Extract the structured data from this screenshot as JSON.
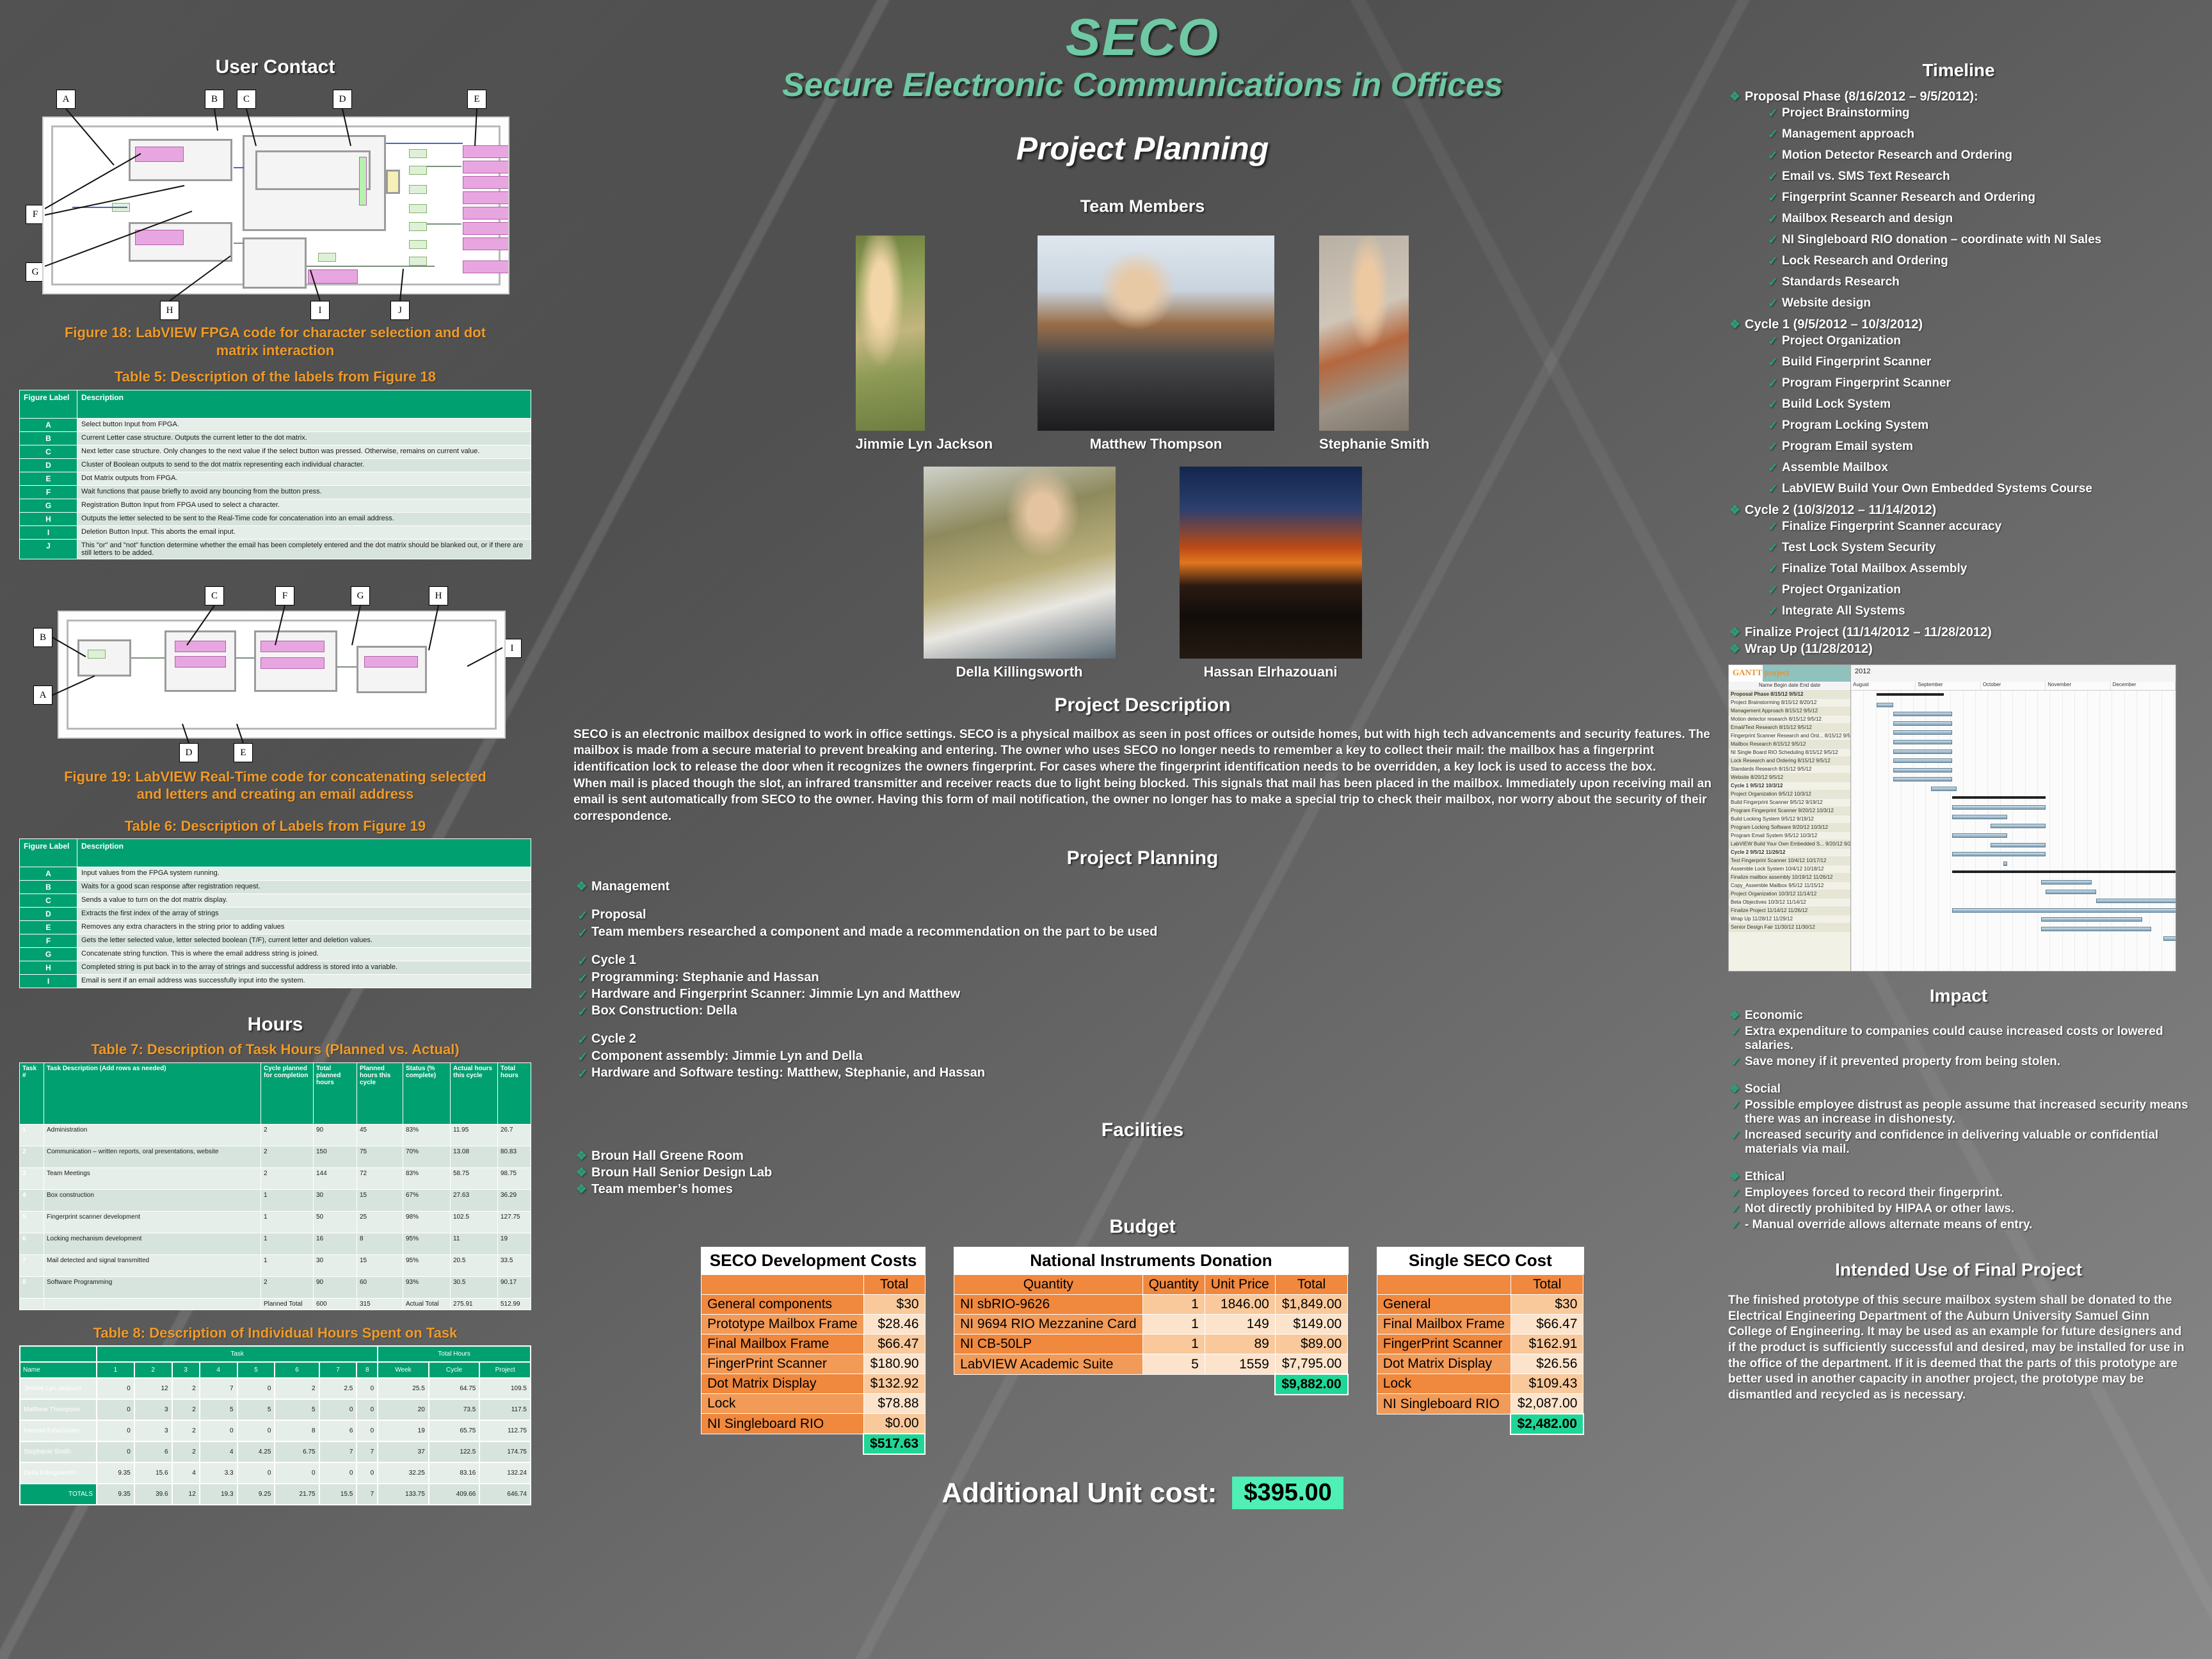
{
  "header": {
    "title": "SECO",
    "subtitle": "Secure Electronic Communications in Offices",
    "phase": "Project Planning",
    "team_members_label": "Team Members"
  },
  "colors": {
    "accent_green": "#2f9e75",
    "table_header_green": "#00a070",
    "budget_orange": "#f0883e",
    "total_green": "#1fd696",
    "caption_orange": "#ef9a28",
    "background": "#4a4a4a"
  },
  "left_column": {
    "figure18_title": "User Contact",
    "figure18_labels": [
      "A",
      "B",
      "C",
      "D",
      "E",
      "F",
      "G",
      "H",
      "I",
      "J"
    ],
    "figure18_caption": "Figure 18: LabVIEW FPGA code for character selection and dot matrix interaction",
    "table5_title": "Table 5: Description of the labels from Figure 18",
    "table5_headers": [
      "Figure Label",
      "Description"
    ],
    "table5_rows": [
      [
        "A",
        "Select button Input from FPGA."
      ],
      [
        "B",
        "Current Letter case structure. Outputs the current letter to the dot matrix."
      ],
      [
        "C",
        "Next letter case structure. Only changes to the next value if the select button was pressed. Otherwise, remains on current value."
      ],
      [
        "D",
        "Cluster of Boolean outputs to send to the dot matrix representing each individual character."
      ],
      [
        "E",
        "Dot Matrix outputs from FPGA."
      ],
      [
        "F",
        "Wait functions that pause briefly to avoid any bouncing from the button press."
      ],
      [
        "G",
        "Registration Button Input from FPGA used to select a character."
      ],
      [
        "H",
        "Outputs the letter selected to be sent to the Real-Time code for concatenation into an email address."
      ],
      [
        "I",
        "Deletion Button Input. This aborts the email input."
      ],
      [
        "J",
        "This \"or\" and \"not\" function determine whether the email has been completely entered and the dot matrix should be blanked out, or if there are still letters to be added."
      ]
    ],
    "figure19_labels": [
      "A",
      "B",
      "C",
      "D",
      "E",
      "F",
      "G",
      "H",
      "I"
    ],
    "figure19_caption": "Figure 19: LabVIEW Real-Time code for concatenating selected and letters and creating an email address",
    "table6_title": "Table 6: Description of Labels from Figure 19",
    "table6_headers": [
      "Figure Label",
      "Description"
    ],
    "table6_rows": [
      [
        "A",
        "Input values from the FPGA system running."
      ],
      [
        "B",
        "Waits for a good scan response after registration request."
      ],
      [
        "C",
        "Sends a value to turn on the dot matrix display."
      ],
      [
        "D",
        "Extracts the first index of the array of strings"
      ],
      [
        "E",
        "Removes any extra characters in the string prior to adding values"
      ],
      [
        "F",
        "Gets the letter selected value, letter selected boolean (T/F), current letter and deletion values."
      ],
      [
        "G",
        "Concatenate string function. This is where the email address string is joined."
      ],
      [
        "H",
        "Completed string is put back in to the array of strings and successful address is stored into a variable."
      ],
      [
        "I",
        "Email is sent if an email address was successfully input into the system."
      ]
    ],
    "hours_title": "Hours",
    "table7_title": "Table 7: Description of Task Hours (Planned vs. Actual)",
    "table7_headers": [
      "Task #",
      "Task Description (Add rows as needed)",
      "Cycle planned for completion",
      "Total planned hours",
      "Planned hours this cycle",
      "Status (% complete)",
      "Actual hours this cycle",
      "Total hours"
    ],
    "table7_rows": [
      [
        "1",
        "Administration",
        "2",
        "90",
        "45",
        "83%",
        "11.95",
        "26.7"
      ],
      [
        "2",
        "Communication – written reports, oral presentations, website",
        "2",
        "150",
        "75",
        "70%",
        "13.08",
        "80.83"
      ],
      [
        "3",
        "Team Meetings",
        "2",
        "144",
        "72",
        "83%",
        "58.75",
        "98.75"
      ],
      [
        "4",
        "Box construction",
        "1",
        "30",
        "15",
        "67%",
        "27.63",
        "36.29"
      ],
      [
        "5",
        "Fingerprint scanner development",
        "1",
        "50",
        "25",
        "98%",
        "102.5",
        "127.75"
      ],
      [
        "6",
        "Locking mechanism development",
        "1",
        "16",
        "8",
        "95%",
        "11",
        "19"
      ],
      [
        "7",
        "Mail detected and signal transmitted",
        "1",
        "30",
        "15",
        "95%",
        "20.5",
        "33.5"
      ],
      [
        "8",
        "Software Programming",
        "2",
        "90",
        "60",
        "93%",
        "30.5",
        "90.17"
      ]
    ],
    "table7_total_row": [
      "",
      "",
      "Planned Total",
      "600",
      "315",
      "Actual Total",
      "275.91",
      "512.99"
    ],
    "table8_title": "Table 8: Description of Individual Hours Spent on Task",
    "table8_group_headers": [
      "",
      "Task",
      "Total Hours"
    ],
    "table8_headers": [
      "Name",
      "1",
      "2",
      "3",
      "4",
      "5",
      "6",
      "7",
      "8",
      "Week",
      "Cycle",
      "Project"
    ],
    "table8_rows": [
      [
        "Jimmie Lyn Jackson",
        "0",
        "12",
        "2",
        "7",
        "0",
        "2",
        "2.5",
        "0",
        "25.5",
        "64.75",
        "109.5"
      ],
      [
        "Matthew Thompson",
        "0",
        "3",
        "2",
        "5",
        "5",
        "5",
        "0",
        "0",
        "20",
        "73.5",
        "117.5"
      ],
      [
        "Hassan Erhazouani",
        "0",
        "3",
        "2",
        "0",
        "0",
        "8",
        "6",
        "0",
        "19",
        "65.75",
        "112.75"
      ],
      [
        "Stephanie Smith",
        "0",
        "6",
        "2",
        "4",
        "4.25",
        "6.75",
        "7",
        "7",
        "37",
        "122.5",
        "174.75"
      ],
      [
        "Della Killingsworth",
        "9.35",
        "15.6",
        "4",
        "3.3",
        "0",
        "0",
        "0",
        "0",
        "32.25",
        "83.16",
        "132.24"
      ],
      [
        "TOTALS",
        "9.35",
        "39.6",
        "12",
        "19.3",
        "9.25",
        "21.75",
        "15.5",
        "7",
        "133.75",
        "409.66",
        "646.74"
      ]
    ]
  },
  "team": [
    {
      "name": "Jimmie Lyn Jackson",
      "photo_class": "ph-jimmie"
    },
    {
      "name": "Matthew Thompson",
      "photo_class": "ph-matthew"
    },
    {
      "name": "Stephanie Smith",
      "photo_class": "ph-stephanie"
    },
    {
      "name": "Della Killingsworth",
      "photo_class": "ph-della"
    },
    {
      "name": "Hassan Elrhazouani",
      "photo_class": "ph-hassan"
    }
  ],
  "project_description": {
    "title": "Project Description",
    "paragraphs": [
      "SECO is an electronic mailbox designed to work in office settings. SECO is a physical mailbox as seen in post offices or outside homes, but with high tech advancements and security features. The mailbox is made from a secure material to prevent breaking and entering. The owner who uses SECO no longer needs to remember a key to collect their mail: the mailbox has a fingerprint identification lock to release the door when it recognizes the owners fingerprint. For cases where the fingerprint identification needs to be overridden, a key lock is used to access the box.",
      "When mail is placed though the slot, an infrared transmitter and receiver reacts due to light being blocked. This signals that mail has been placed in the mailbox. Immediately upon receiving mail an email is sent automatically from SECO to the owner. Having this form of mail notification, the owner no longer has to make a special trip to check their mailbox, nor worry about the security of their correspondence."
    ]
  },
  "project_planning": {
    "title": "Project Planning",
    "groups": [
      {
        "heading": "Management",
        "items": []
      },
      {
        "heading": "Proposal",
        "items": [
          "Team members researched a component and made a recommendation on the part to be used"
        ]
      },
      {
        "heading": "Cycle 1",
        "items": [
          "Programming: Stephanie and Hassan",
          "Hardware and Fingerprint Scanner: Jimmie Lyn and Matthew",
          "Box Construction: Della"
        ]
      },
      {
        "heading": "Cycle 2",
        "items": [
          "Component assembly: Jimmie Lyn and Della",
          "Hardware and Software testing: Matthew, Stephanie, and Hassan"
        ]
      }
    ]
  },
  "facilities": {
    "title": "Facilities",
    "items": [
      "Broun Hall Greene Room",
      "Broun Hall Senior Design Lab",
      "Team member’s homes"
    ]
  },
  "budget": {
    "title": "Budget",
    "tables": [
      {
        "caption": "SECO Development Costs",
        "headers": [
          "",
          "Total"
        ],
        "rows": [
          [
            "General components",
            "$30"
          ],
          [
            "Prototype Mailbox Frame",
            "$28.46"
          ],
          [
            "Final Mailbox Frame",
            "$66.47"
          ],
          [
            "FingerPrint Scanner",
            "$180.90"
          ],
          [
            "Dot Matrix Display",
            "$132.92"
          ],
          [
            "Lock",
            "$78.88"
          ],
          [
            "NI Singleboard RIO",
            "$0.00"
          ]
        ],
        "total": "$517.63"
      },
      {
        "caption": "National Instruments Donation",
        "headers": [
          "Quantity",
          "Quantity",
          "Unit Price",
          "Total"
        ],
        "rows": [
          [
            "NI sbRIO-9626",
            "1",
            "1846.00",
            "$1,849.00"
          ],
          [
            "NI 9694 RIO Mezzanine Card",
            "1",
            "149",
            "$149.00"
          ],
          [
            "NI CB-50LP",
            "1",
            "89",
            "$89.00"
          ],
          [
            "LabVIEW Academic Suite",
            "5",
            "1559",
            "$7,795.00"
          ]
        ],
        "total": "$9,882.00"
      },
      {
        "caption": "Single SECO Cost",
        "headers": [
          "",
          "Total"
        ],
        "rows": [
          [
            "General",
            "$30"
          ],
          [
            "Final Mailbox Frame",
            "$66.47"
          ],
          [
            "FingerPrint Scanner",
            "$162.91"
          ],
          [
            "Dot Matrix Display",
            "$26.56"
          ],
          [
            "Lock",
            "$109.43"
          ],
          [
            "NI Singleboard RIO",
            "$2,087.00"
          ]
        ],
        "total": "$2,482.00"
      }
    ],
    "additional_unit_label": "Additional Unit cost:",
    "additional_unit_value": "$395.00"
  },
  "timeline": {
    "title": "Timeline",
    "phases": [
      {
        "label": "Proposal Phase (8/16/2012 – 9/5/2012):",
        "tasks": [
          "Project Brainstorming",
          "Management approach",
          "Motion Detector Research and Ordering",
          "Email vs. SMS Text Research",
          "Fingerprint Scanner Research and Ordering",
          "Mailbox Research and design",
          "NI Singleboard RIO donation – coordinate with NI Sales",
          "Lock Research and Ordering",
          "Standards Research",
          "Website design"
        ]
      },
      {
        "label": "Cycle 1 (9/5/2012 – 10/3/2012)",
        "tasks": [
          "Project Organization",
          "Build Fingerprint Scanner",
          "Program Fingerprint Scanner",
          "Build Lock System",
          "Program Locking System",
          "Program Email system",
          "Assemble Mailbox",
          "LabVIEW Build Your Own Embedded Systems Course"
        ]
      },
      {
        "label": "Cycle 2 (10/3/2012 – 11/14/2012)",
        "tasks": [
          "Finalize Fingerprint Scanner accuracy",
          "Test Lock System Security",
          "Finalize Total  Mailbox Assembly",
          "Project Organization",
          "Integrate All Systems"
        ]
      },
      {
        "label": "Finalize Project (11/14/2012 – 11/28/2012)",
        "tasks": []
      },
      {
        "label": "Wrap Up (11/28/2012)",
        "tasks": []
      }
    ]
  },
  "gantt": {
    "app_name": "GANTT project",
    "year": "2012",
    "months": [
      "August",
      "September",
      "October",
      "November",
      "December"
    ],
    "columns": [
      "Name",
      "Begin date",
      "End date"
    ],
    "rows": [
      {
        "name": "Proposal Phase",
        "begin": "8/15/12",
        "end": "9/5/12",
        "summary": true,
        "start": 6,
        "len": 16
      },
      {
        "name": "Project Brainstorming",
        "begin": "8/15/12",
        "end": "8/20/12",
        "start": 6,
        "len": 4
      },
      {
        "name": "Management Approach",
        "begin": "8/15/12",
        "end": "9/5/12",
        "start": 10,
        "len": 14
      },
      {
        "name": "Motion detector research",
        "begin": "8/15/12",
        "end": "9/5/12",
        "start": 10,
        "len": 14
      },
      {
        "name": "Email/Text Research",
        "begin": "8/15/12",
        "end": "9/5/12",
        "start": 10,
        "len": 14
      },
      {
        "name": "Fingerprint Scanner Research and Ord...",
        "begin": "8/15/12",
        "end": "9/5/12",
        "start": 10,
        "len": 14
      },
      {
        "name": "Mailbox Research",
        "begin": "8/15/12",
        "end": "9/5/12",
        "start": 10,
        "len": 14
      },
      {
        "name": "NI Single Board RIO Scheduling",
        "begin": "8/15/12",
        "end": "9/5/12",
        "start": 10,
        "len": 14
      },
      {
        "name": "Lock Research and Ordering",
        "begin": "8/15/12",
        "end": "9/5/12",
        "start": 10,
        "len": 14
      },
      {
        "name": "Standards Research",
        "begin": "8/15/12",
        "end": "9/5/12",
        "start": 10,
        "len": 14
      },
      {
        "name": "Website",
        "begin": "8/20/12",
        "end": "9/5/12",
        "start": 19,
        "len": 6
      },
      {
        "name": "Cycle 1",
        "begin": "9/5/12",
        "end": "10/3/12",
        "summary": true,
        "start": 24,
        "len": 22
      },
      {
        "name": "Project Organization",
        "begin": "9/5/12",
        "end": "10/3/12",
        "start": 24,
        "len": 22
      },
      {
        "name": "Build Fingerprint Scanner",
        "begin": "9/5/12",
        "end": "9/19/12",
        "start": 24,
        "len": 13
      },
      {
        "name": "Program Fingerprint Scanner",
        "begin": "9/20/12",
        "end": "10/3/12",
        "start": 33,
        "len": 13
      },
      {
        "name": "Build Locking System",
        "begin": "9/5/12",
        "end": "9/19/12",
        "start": 24,
        "len": 13
      },
      {
        "name": "Program Locking Software",
        "begin": "9/20/12",
        "end": "10/3/12",
        "start": 33,
        "len": 13
      },
      {
        "name": "Program Email System",
        "begin": "9/5/12",
        "end": "10/3/12",
        "start": 24,
        "len": 22
      },
      {
        "name": "LabVIEW Build Your Own Embedded S...",
        "begin": "9/20/12",
        "end": "9/20/12",
        "start": 36,
        "len": 1
      },
      {
        "name": "Cycle 2",
        "begin": "9/5/12",
        "end": "11/26/12",
        "summary": true,
        "start": 24,
        "len": 62
      },
      {
        "name": "Test Fingerprint Scanner",
        "begin": "10/4/12",
        "end": "10/17/12",
        "start": 45,
        "len": 12
      },
      {
        "name": "Assemble Lock System",
        "begin": "10/4/12",
        "end": "10/18/12",
        "start": 46,
        "len": 12
      },
      {
        "name": "Finalize mailbox assembly",
        "begin": "10/19/12",
        "end": "11/26/12",
        "start": 58,
        "len": 28
      },
      {
        "name": "Copy_Assemble Mailbox",
        "begin": "9/5/12",
        "end": "11/15/12",
        "start": 24,
        "len": 55
      },
      {
        "name": "Project Organization",
        "begin": "10/3/12",
        "end": "11/14/12",
        "start": 45,
        "len": 24
      },
      {
        "name": "Beta Objectives",
        "begin": "10/3/12",
        "end": "11/14/12",
        "start": 45,
        "len": 26
      },
      {
        "name": "Finalize Project",
        "begin": "11/14/12",
        "end": "11/26/12",
        "start": 74,
        "len": 12
      },
      {
        "name": "Wrap Up",
        "begin": "11/28/12",
        "end": "11/29/12",
        "start": 86,
        "len": 1
      },
      {
        "name": "Senior Design Fair",
        "begin": "11/30/12",
        "end": "11/30/12",
        "start": 87,
        "len": 1
      }
    ]
  },
  "impact": {
    "title": "Impact",
    "groups": [
      {
        "heading": "Economic",
        "items": [
          " Extra expenditure to companies could cause increased costs or lowered salaries.",
          " Save money if it prevented property from being stolen."
        ]
      },
      {
        "heading": "Social",
        "items": [
          "Possible employee distrust as people assume that increased security means there was an increase in dishonesty.",
          " Increased security and confidence in delivering valuable or confidential materials via mail."
        ]
      },
      {
        "heading": "Ethical",
        "items": [
          " Employees forced to record their fingerprint.",
          " Not directly prohibited by HIPAA or other laws.",
          "- Manual override allows alternate means of entry."
        ]
      }
    ]
  },
  "intended_use": {
    "title": "Intended Use of Final Project",
    "text": "The finished prototype of this secure mailbox system shall be donated to the Electrical Engineering Department of the Auburn University Samuel Ginn College of Engineering.  It may be used as an example for future designers and if the product is sufficiently successful and desired, may be installed for use in the office of the department.  If it is deemed that the parts of this prototype are better used in another capacity in another project, the prototype may be dismantled and recycled as is necessary."
  }
}
